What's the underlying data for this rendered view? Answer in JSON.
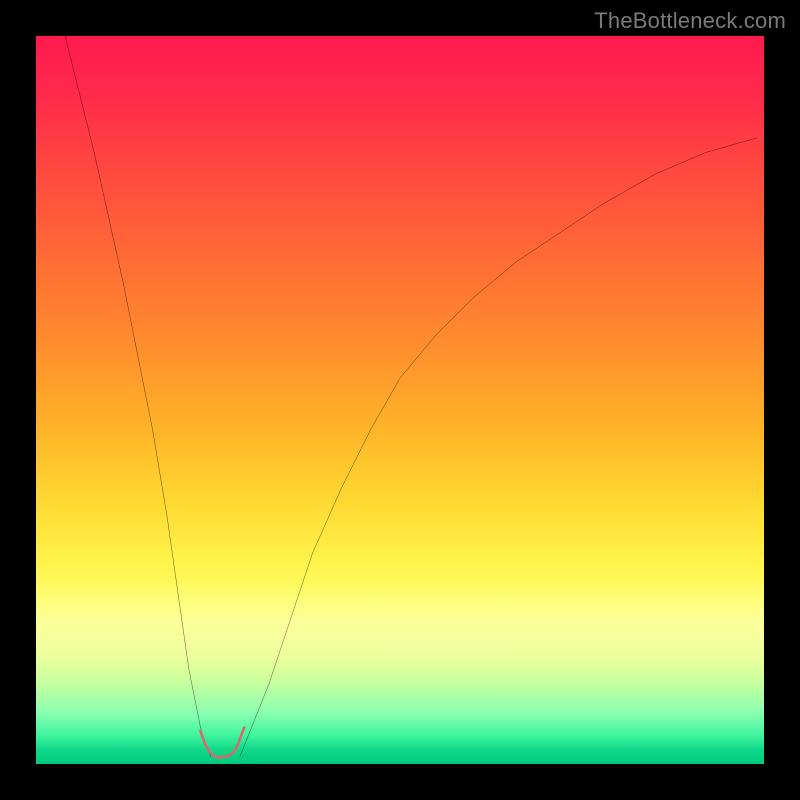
{
  "attribution": "TheBottleneck.com",
  "svg_aria": "bottleneck-curve",
  "chart_data": {
    "type": "line",
    "title": "",
    "xlabel": "",
    "ylabel": "",
    "xlim": [
      0,
      100
    ],
    "ylim": [
      0,
      100
    ],
    "grid": false,
    "legend": false,
    "series": [
      {
        "name": "left-branch",
        "x": [
          4,
          6,
          8,
          10,
          12,
          14,
          16,
          18,
          19,
          20,
          21,
          22,
          22.6,
          23.2,
          23.6,
          24
        ],
        "y": [
          100,
          92,
          84,
          75,
          66,
          56,
          46,
          34,
          27,
          20,
          13,
          8,
          5,
          3,
          2,
          1
        ]
      },
      {
        "name": "right-branch",
        "x": [
          28,
          28.4,
          28.8,
          30,
          32,
          35,
          38,
          42,
          46,
          50,
          55,
          60,
          66,
          72,
          78,
          85,
          92,
          99
        ],
        "y": [
          1,
          2,
          3,
          6,
          11,
          20,
          29,
          38,
          46,
          53,
          59,
          64,
          69,
          73,
          77,
          81,
          84,
          86
        ]
      },
      {
        "name": "u-marker",
        "x": [
          22.6,
          23.2,
          23.8,
          24.4,
          25.1,
          25.8,
          26.5,
          27.2,
          27.8,
          28.2,
          28.6
        ],
        "y": [
          4.5,
          2.8,
          1.7,
          1.1,
          0.9,
          1.0,
          1.1,
          1.7,
          2.8,
          4.0,
          5.0
        ]
      }
    ],
    "colors": {
      "curve": "#000000",
      "u_marker": "#d76a6e",
      "gradient_top": "#ff1a4e",
      "gradient_bottom": "#00c97e"
    },
    "notes": "V-shaped bottleneck curve on a red-to-green vertical gradient. Minimum near x≈25, y≈1. Values estimated from plot pixels; axes have no tick labels."
  }
}
